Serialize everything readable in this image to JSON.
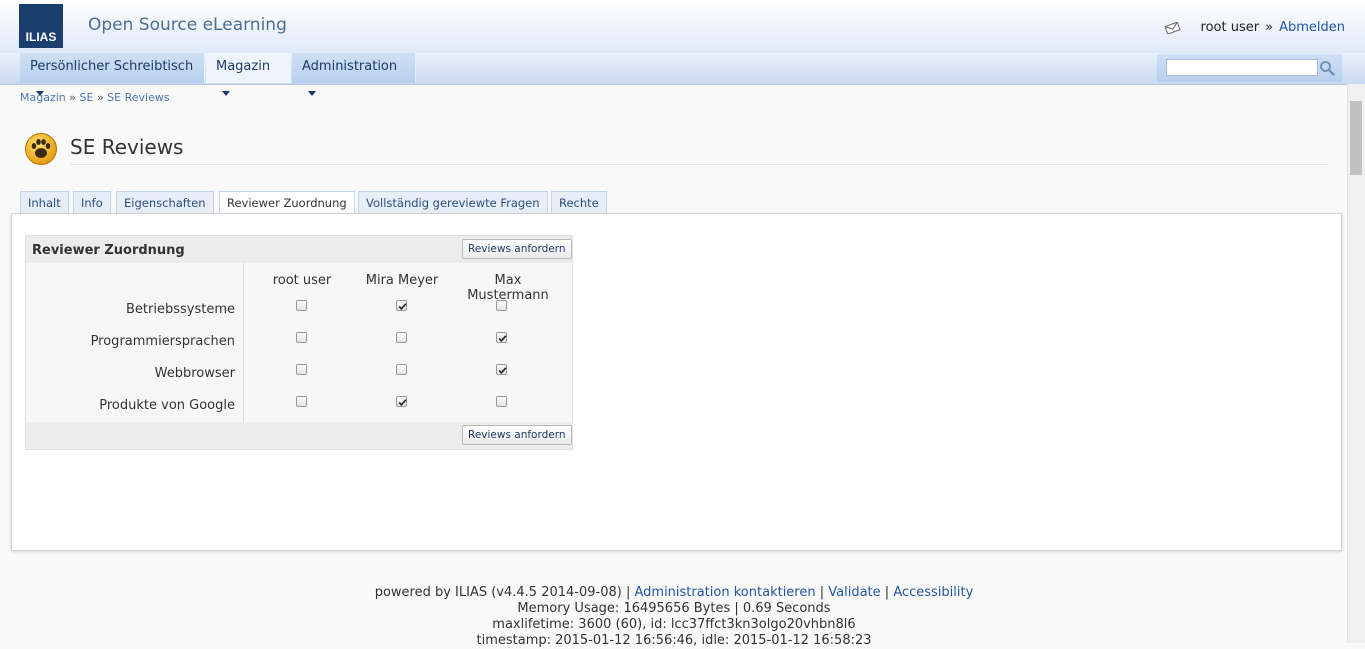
{
  "header": {
    "logo_text": "ILIAS",
    "site_title": "Open Source eLearning",
    "user_name": "root user",
    "separator": "»",
    "logout_label": "Abmelden"
  },
  "nav": {
    "items": [
      {
        "label": "Persönlicher Schreibtisch"
      },
      {
        "label": "Magazin"
      },
      {
        "label": "Administration"
      }
    ],
    "search_value": ""
  },
  "breadcrumb": {
    "items": [
      "Magazin",
      "SE",
      "SE Reviews"
    ],
    "separator": "»"
  },
  "page": {
    "title": "SE Reviews"
  },
  "tabs": [
    "Inhalt",
    "Info",
    "Eigenschaften",
    "Reviewer Zuordnung",
    "Vollständig gereviewte Fragen",
    "Rechte"
  ],
  "active_tab": "Reviewer Zuordnung",
  "assignment_table": {
    "title": "Reviewer Zuordnung",
    "request_button": "Reviews anfordern",
    "columns": [
      "root user",
      "Mira Meyer",
      "Max Mustermann"
    ],
    "rows": [
      {
        "label": "Betriebssysteme",
        "checked": [
          false,
          true,
          false
        ]
      },
      {
        "label": "Programmiersprachen",
        "checked": [
          false,
          false,
          true
        ]
      },
      {
        "label": "Webbrowser",
        "checked": [
          false,
          false,
          true
        ]
      },
      {
        "label": "Produkte von Google",
        "checked": [
          false,
          true,
          false
        ]
      }
    ]
  },
  "footer": {
    "powered": "powered by ILIAS (v4.4.5 2014-09-08)",
    "links": [
      "Administration kontaktieren",
      "Validate",
      "Accessibility"
    ],
    "memory": "Memory Usage: 16495656 Bytes | 0.69 Seconds",
    "session": "maxlifetime: 3600 (60), id: lcc37ffct3kn3olgo20vhbn8l6",
    "timestamp": "timestamp: 2015-01-12 16:56:46, idle: 2015-01-12 16:58:23"
  },
  "colors": {
    "link": "#2255a4",
    "logo_bg": "#1a3f6f",
    "nav_bg": "#b7cfee"
  }
}
